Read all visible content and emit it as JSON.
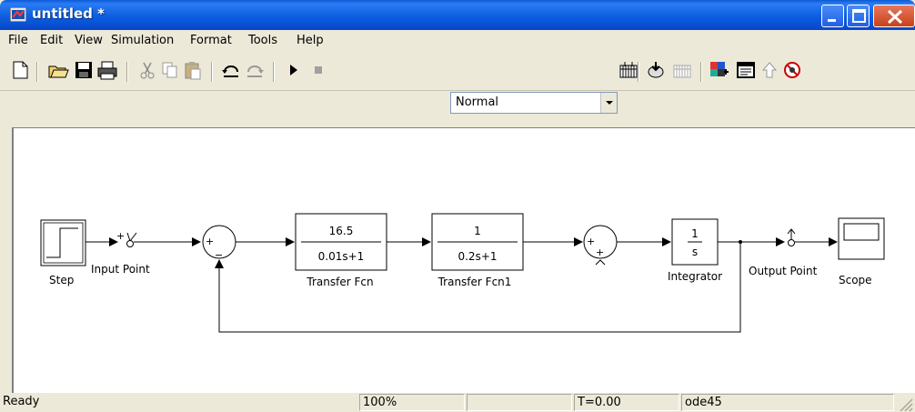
{
  "window": {
    "title": "untitled *"
  },
  "menu": [
    "File",
    "Edit",
    "View",
    "Simulation",
    "Format",
    "Tools",
    "Help"
  ],
  "toolbar": {
    "icons": [
      "new-model-icon",
      "open-icon",
      "save-icon",
      "print-icon",
      "cut-icon",
      "copy-icon",
      "paste-icon",
      "undo-icon",
      "redo-icon",
      "start-simulation-icon",
      "stop-simulation-icon",
      "build-icon",
      "update-diagram-icon",
      "refresh-icon",
      "library-browser-icon",
      "model-explorer-icon",
      "go-to-parent-icon",
      "debugger-icon"
    ],
    "sim_mode": "Normal"
  },
  "diagram": {
    "blocks": {
      "step": "Step",
      "input_point": "Input Point",
      "tf1_num": "16.5",
      "tf1_den": "0.01s+1",
      "tf1_label": "Transfer Fcn",
      "tf2_num": "1",
      "tf2_den": "0.2s+1",
      "tf2_label": "Transfer Fcn1",
      "integrator_num": "1",
      "integrator_den": "s",
      "integrator_label": "Integrator",
      "output_point": "Output Point",
      "scope": "Scope"
    },
    "signs": {
      "sum1_plus": "+",
      "sum1_minus": "−",
      "sum2_plus_left": "+",
      "sum2_plus_bottom": "+"
    }
  },
  "status": {
    "state": "Ready",
    "zoom": "100%",
    "blank": "",
    "time": "T=0.00",
    "solver": "ode45"
  }
}
